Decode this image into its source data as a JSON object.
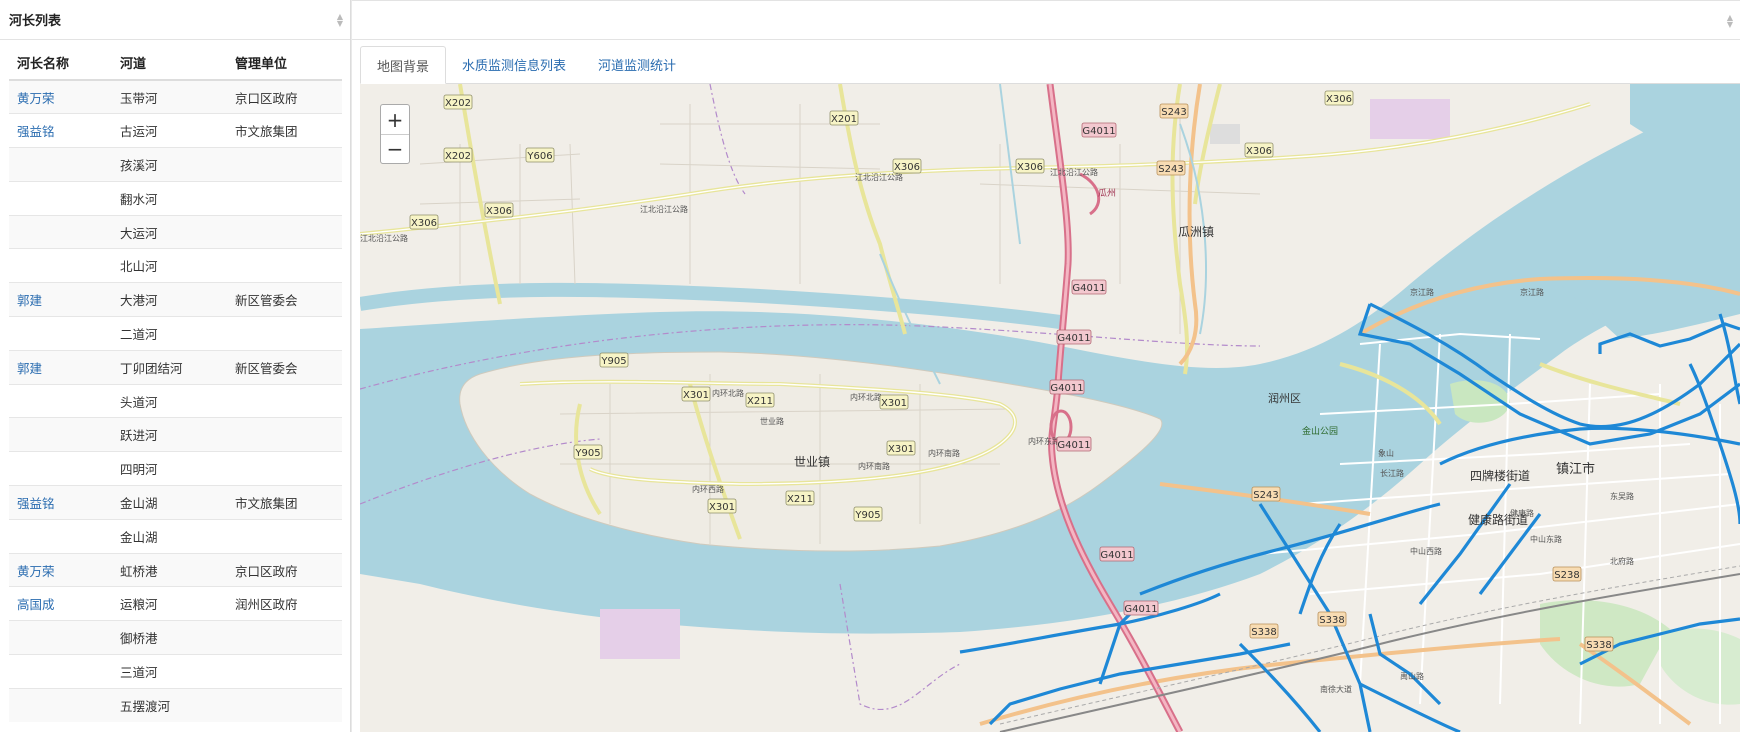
{
  "left_panel": {
    "title": "河长列表",
    "columns": [
      "河长名称",
      "河道",
      "管理单位"
    ],
    "rows": [
      {
        "chief": "黄万荣",
        "river": "玉带河",
        "unit": "京口区政府"
      },
      {
        "chief": "强益铭",
        "river": "古运河",
        "unit": "市文旅集团"
      },
      {
        "chief": "",
        "river": "孩溪河",
        "unit": ""
      },
      {
        "chief": "",
        "river": "翻水河",
        "unit": ""
      },
      {
        "chief": "",
        "river": "大运河",
        "unit": ""
      },
      {
        "chief": "",
        "river": "北山河",
        "unit": ""
      },
      {
        "chief": "郭建",
        "river": "大港河",
        "unit": "新区管委会"
      },
      {
        "chief": "",
        "river": "二道河",
        "unit": ""
      },
      {
        "chief": "郭建",
        "river": "丁卯团结河",
        "unit": "新区管委会"
      },
      {
        "chief": "",
        "river": "头道河",
        "unit": ""
      },
      {
        "chief": "",
        "river": "跃进河",
        "unit": ""
      },
      {
        "chief": "",
        "river": "四明河",
        "unit": ""
      },
      {
        "chief": "强益铭",
        "river": "金山湖",
        "unit": "市文旅集团"
      },
      {
        "chief": "",
        "river": "金山湖",
        "unit": ""
      },
      {
        "chief": "黄万荣",
        "river": "虹桥港",
        "unit": "京口区政府"
      },
      {
        "chief": "高国成",
        "river": "运粮河",
        "unit": "润州区政府"
      },
      {
        "chief": "",
        "river": "御桥港",
        "unit": ""
      },
      {
        "chief": "",
        "river": "三道河",
        "unit": ""
      },
      {
        "chief": "",
        "river": "五摆渡河",
        "unit": ""
      }
    ]
  },
  "right_panel": {
    "tabs": [
      {
        "label": "地图背景",
        "active": true
      },
      {
        "label": "水质监测信息列表",
        "active": false
      },
      {
        "label": "河道监测统计",
        "active": false
      }
    ],
    "zoom": {
      "in": "+",
      "out": "−"
    },
    "map": {
      "place_labels": [
        "瓜洲镇",
        "世业镇",
        "润州区",
        "金山公园",
        "四牌楼街道",
        "镇江市",
        "健康路街道",
        "瓜州"
      ],
      "road_badges": [
        "X202",
        "X202",
        "Y606",
        "X306",
        "X306",
        "X201",
        "X306",
        "X306",
        "X306",
        "X306",
        "Y905",
        "Y905",
        "Y905",
        "X301",
        "X301",
        "X301",
        "X301",
        "X211",
        "X211"
      ],
      "highway_badges": [
        "G4011",
        "G4011",
        "G4011",
        "G4011",
        "G4011",
        "G4011",
        "G4011"
      ],
      "provincial_badges": [
        "S243",
        "S243",
        "S243",
        "S338",
        "S338",
        "S238",
        "S338"
      ],
      "road_names": [
        "江北沿江公路",
        "江北沿江公路",
        "江北沿江公路",
        "江北沿江公路",
        "内环北路",
        "内环北路",
        "内环南路",
        "内环南路",
        "内环西路",
        "世业路",
        "内环东路",
        "京江路",
        "京江路",
        "长江路",
        "中山西路",
        "中山东路",
        "健康路",
        "南徐大道",
        "东吴路",
        "北府路",
        "禹山路",
        "象山"
      ],
      "colors": {
        "water": "#aad3df",
        "land": "#f1eee8",
        "river_overlay": "#1e88d6",
        "highway": "#e892a2",
        "secondary_road": "#f7fabf"
      }
    }
  }
}
